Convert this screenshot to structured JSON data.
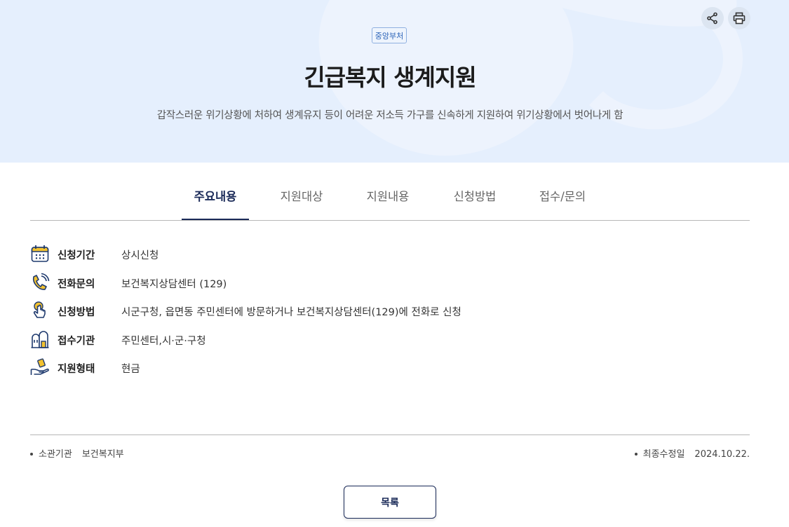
{
  "hero": {
    "badge": "중앙부처",
    "title": "긴급복지 생계지원",
    "subtitle": "갑작스러운 위기상황에 처하여 생계유지 등이 어려운 저소득 가구를 신속하게 지원하여 위기상황에서 벗어나게 함",
    "background_color": "#e5effd"
  },
  "toolbar": {
    "share_icon": "share-icon",
    "print_icon": "print-icon"
  },
  "tabs": [
    {
      "label": "주요내용",
      "active": true
    },
    {
      "label": "지원대상",
      "active": false
    },
    {
      "label": "지원내용",
      "active": false
    },
    {
      "label": "신청방법",
      "active": false
    },
    {
      "label": "접수/문의",
      "active": false
    }
  ],
  "info": [
    {
      "icon": "calendar-icon",
      "label": "신청기간",
      "value": "상시신청"
    },
    {
      "icon": "phone-icon",
      "label": "전화문의",
      "value": "보건복지상담센터 (129)"
    },
    {
      "icon": "hand-pointer-icon",
      "label": "신청방법",
      "value": "시군구청, 읍면동 주민센터에 방문하거나 보건복지상담센터(129)에 전화로 신청"
    },
    {
      "icon": "building-icon",
      "label": "접수기관",
      "value": "주민센터,시·군·구청"
    },
    {
      "icon": "hand-money-icon",
      "label": "지원형태",
      "value": "현금"
    }
  ],
  "footer": {
    "agency_label": "소관기관",
    "agency_value": "보건복지부",
    "updated_label": "최종수정일",
    "updated_value": "2024.10.22."
  },
  "list_button": "목록",
  "colors": {
    "accent": "#1a2a58",
    "icon_fill": "#f2c230",
    "icon_stroke": "#1f3a6e"
  }
}
